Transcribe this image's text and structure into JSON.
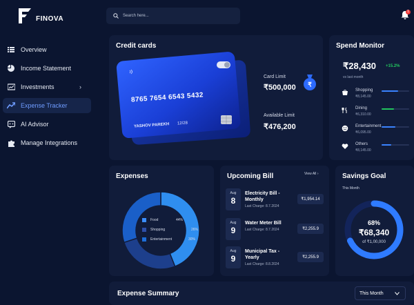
{
  "app": {
    "name": "FINOVA"
  },
  "sidebar": {
    "items": [
      {
        "label": "Overview",
        "icon": "overview-icon",
        "active": false
      },
      {
        "label": "Income Statement",
        "icon": "pie-chart-icon",
        "active": false
      },
      {
        "label": "Investments",
        "icon": "investments-icon",
        "active": false,
        "chevron": "›"
      },
      {
        "label": "Expense Tracker",
        "icon": "trend-icon",
        "active": true
      },
      {
        "label": "AI Advisor",
        "icon": "chat-icon",
        "active": false
      },
      {
        "label": "Manage Integrations",
        "icon": "puzzle-icon",
        "active": false
      }
    ]
  },
  "search": {
    "placeholder": "Search here..."
  },
  "notifications": {
    "count": "1"
  },
  "credit_cards": {
    "title": "Credit cards",
    "card_number": "8765 7654 6543 5432",
    "holder": "YASHOV PAREKH",
    "expiry": "12/28",
    "limit_label": "Card Limit",
    "limit_value": "₹500,000",
    "available_label": "Available Limit",
    "available_value": "₹476,200"
  },
  "spend_monitor": {
    "title": "Spend Monitor",
    "total": "₹28,430",
    "change": "+15.2%",
    "period": "vs last month",
    "categories": [
      {
        "name": "Shopping",
        "amount": "₹8,145.00",
        "icon": "shopping-icon",
        "fill": 0.6,
        "color": "#3a83ff"
      },
      {
        "name": "Dining",
        "amount": "₹6,310.00",
        "icon": "dining-icon",
        "fill": 0.45,
        "color": "#22c55e"
      },
      {
        "name": "Entertainment",
        "amount": "₹6,095.00",
        "icon": "entertainment-icon",
        "fill": 0.5,
        "color": "#3a83ff"
      },
      {
        "name": "Others",
        "amount": "₹8,145.00",
        "icon": "heart-icon",
        "fill": 0.35,
        "color": "#3a83ff"
      }
    ]
  },
  "expenses": {
    "title": "Expenses",
    "legend": [
      {
        "label": "Food",
        "color": "#3a8dff"
      },
      {
        "label": "Shopping",
        "color": "#2d4fa8"
      },
      {
        "label": "Entertainment",
        "color": "#1c6dd8"
      }
    ],
    "slices": [
      {
        "label": "Food",
        "value": 44,
        "color": "#2f8eef"
      },
      {
        "label": "Shopping",
        "value": 26,
        "color": "#1d3f8c"
      },
      {
        "label": "Entertainment",
        "value": 30,
        "color": "#1a5fc8"
      }
    ],
    "pct_labels": {
      "food": "44%",
      "shopping": "26%",
      "entertainment": "30%"
    }
  },
  "upcoming_bill": {
    "title": "Upcoming Bill",
    "view_all": "View All",
    "bills": [
      {
        "month": "Aug",
        "day": "8",
        "name": "Electricity Bill - Monthly",
        "charge": "Last Charge: 8.7.2024",
        "amount": "₹1,954.14"
      },
      {
        "month": "Aug",
        "day": "9",
        "name": "Water Meter Bill",
        "charge": "Last Charge: 8.7.2024",
        "amount": "₹2,255.9"
      },
      {
        "month": "Aug",
        "day": "9",
        "name": "Municipal Tax - Yearly",
        "charge": "Last Charge: 8.8.2024",
        "amount": "₹2,255.9"
      }
    ]
  },
  "savings_goal": {
    "title": "Savings Goal",
    "period": "This Month",
    "percent": "68%",
    "progress": 0.68,
    "saved": "₹68,340",
    "target": "of ₹1,00,000"
  },
  "expense_summary": {
    "title": "Expense Summary",
    "range": "This Month"
  },
  "colors": {
    "accent": "#3a83ff",
    "positive": "#22c55e",
    "badge": "#ef3b3b"
  }
}
